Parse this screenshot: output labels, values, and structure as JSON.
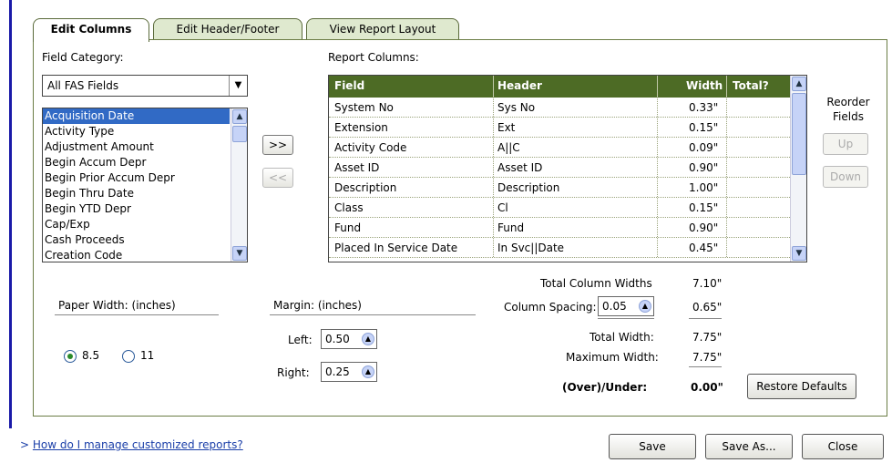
{
  "tabs": [
    {
      "label": "Edit Columns",
      "active": true
    },
    {
      "label": "Edit Header/Footer",
      "active": false
    },
    {
      "label": "View Report Layout",
      "active": false
    }
  ],
  "field_category": {
    "label": "Field Category:",
    "selected": "All FAS Fields",
    "fields": [
      "Acquisition Date",
      "Activity Type",
      "Adjustment Amount",
      "Begin Accum Depr",
      "Begin Prior Accum Depr",
      "Begin Thru Date",
      "Begin YTD Depr",
      "Cap/Exp",
      "Cash Proceeds",
      "Creation Code"
    ],
    "selected_field": "Acquisition Date"
  },
  "move_buttons": {
    "add": ">>",
    "remove": "<<"
  },
  "report_columns": {
    "label": "Report Columns:",
    "headers": [
      "Field",
      "Header",
      "Width",
      "Total?"
    ],
    "rows": [
      {
        "field": "System No",
        "header": "Sys No",
        "width": "0.33\"",
        "total": ""
      },
      {
        "field": "Extension",
        "header": "Ext",
        "width": "0.15\"",
        "total": ""
      },
      {
        "field": "Activity Code",
        "header": "A||C",
        "width": "0.09\"",
        "total": ""
      },
      {
        "field": "Asset ID",
        "header": "Asset ID",
        "width": "0.90\"",
        "total": ""
      },
      {
        "field": "Description",
        "header": "Description",
        "width": "1.00\"",
        "total": ""
      },
      {
        "field": "Class",
        "header": "Cl",
        "width": "0.15\"",
        "total": ""
      },
      {
        "field": "Fund",
        "header": "Fund",
        "width": "0.90\"",
        "total": ""
      },
      {
        "field": "Placed In Service Date",
        "header": "In Svc||Date",
        "width": "0.45\"",
        "total": ""
      }
    ]
  },
  "reorder": {
    "label": "Reorder Fields",
    "up": "Up",
    "down": "Down"
  },
  "paper": {
    "label": "Paper Width: (inches)",
    "opt1": "8.5",
    "opt2": "11",
    "selected": "8.5"
  },
  "margin": {
    "label": "Margin: (inches)",
    "left_label": "Left:",
    "left": "0.50",
    "right_label": "Right:",
    "right": "0.25"
  },
  "totals": {
    "total_column_widths_label": "Total Column Widths",
    "total_column_widths": "7.10\"",
    "column_spacing_label": "Column Spacing:",
    "column_spacing": "0.05",
    "column_spacing_total": "0.65\"",
    "total_width_label": "Total Width:",
    "total_width": "7.75\"",
    "maximum_width_label": "Maximum Width:",
    "maximum_width": "7.75\"",
    "over_under_label": "(Over)/Under:",
    "over_under": "0.00\""
  },
  "buttons": {
    "restore": "Restore Defaults",
    "save": "Save",
    "save_as": "Save As...",
    "close": "Close"
  },
  "help_link": "How do I manage customized reports?"
}
